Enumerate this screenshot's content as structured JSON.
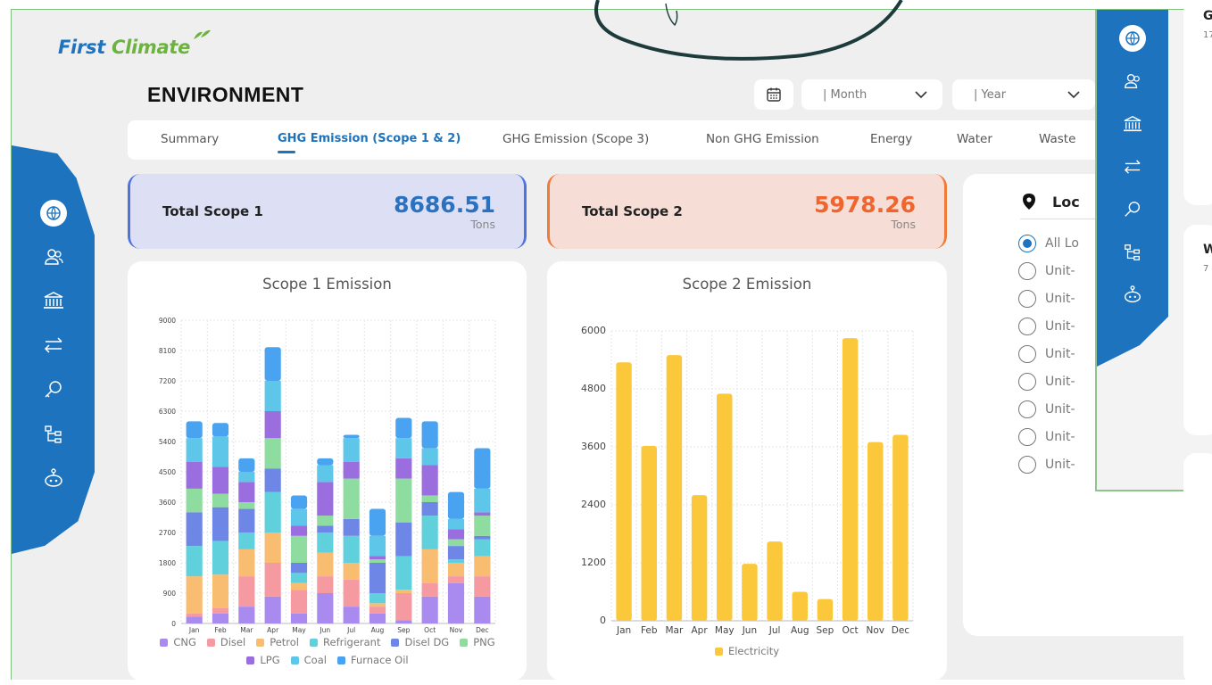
{
  "brand": {
    "name_first": "First",
    "name_second": "Climate",
    "colors": {
      "primary": "#1e73be",
      "green": "#6cb33f"
    }
  },
  "page_title": "ENVIRONMENT",
  "filters": {
    "month": "| Month",
    "year": "| Year"
  },
  "tabs": [
    {
      "label": "Summary",
      "active": false
    },
    {
      "label": "GHG Emission (Scope 1 & 2)",
      "active": true
    },
    {
      "label": "GHG Emission (Scope 3)",
      "active": false
    },
    {
      "label": "Non GHG Emission",
      "active": false
    },
    {
      "label": "Energy",
      "active": false
    },
    {
      "label": "Water",
      "active": false
    },
    {
      "label": "Waste",
      "active": false
    }
  ],
  "sidebar_icons": [
    "globe-icon",
    "users-icon",
    "building-icon",
    "transfer-icon",
    "leaf-key-icon",
    "hierarchy-icon",
    "robot-icon"
  ],
  "totals": {
    "scope1": {
      "label": "Total Scope 1",
      "value": "8686.51",
      "unit": "Tons",
      "color": "#2a72c0"
    },
    "scope2": {
      "label": "Total Scope 2",
      "value": "5978.26",
      "unit": "Tons",
      "color": "#f0642e"
    }
  },
  "location": {
    "title": "Loc",
    "options": [
      "All Lo",
      "Unit-",
      "Unit-",
      "Unit-",
      "Unit-",
      "Unit-",
      "Unit-",
      "Unit-",
      "Unit-"
    ],
    "selected_index": 0
  },
  "overlay_cards": [
    {
      "title": "G",
      "sub": "17"
    },
    {
      "title": "W",
      "sub": "7"
    }
  ],
  "chart_data": [
    {
      "type": "bar",
      "stacked": true,
      "title": "Scope 1 Emission",
      "categories": [
        "Jan",
        "Feb",
        "Mar",
        "Apr",
        "May",
        "Jun",
        "Jul",
        "Aug",
        "Sep",
        "Oct",
        "Nov",
        "Dec"
      ],
      "ylim": [
        0,
        9000
      ],
      "yticks": [
        0,
        900,
        1800,
        2700,
        3600,
        4500,
        5400,
        6300,
        7200,
        8100,
        9000
      ],
      "series": [
        {
          "name": "CNG",
          "color": "#a98bf0",
          "values": [
            200,
            300,
            500,
            800,
            300,
            900,
            500,
            300,
            100,
            800,
            1200,
            800
          ]
        },
        {
          "name": "Disel",
          "color": "#f59aa0",
          "values": [
            100,
            150,
            900,
            1000,
            700,
            500,
            800,
            200,
            800,
            400,
            200,
            600
          ]
        },
        {
          "name": "Petrol",
          "color": "#f9bd72",
          "values": [
            1100,
            1000,
            800,
            900,
            200,
            700,
            500,
            100,
            100,
            1000,
            400,
            600
          ]
        },
        {
          "name": "Refrigerant",
          "color": "#5fd0dc",
          "values": [
            900,
            1000,
            500,
            1200,
            300,
            600,
            800,
            300,
            1000,
            1000,
            100,
            500
          ]
        },
        {
          "name": "Disel DG",
          "color": "#6e86e6",
          "values": [
            1000,
            1000,
            700,
            700,
            300,
            200,
            500,
            900,
            1000,
            400,
            400,
            100
          ]
        },
        {
          "name": "PNG",
          "color": "#8fdca0",
          "values": [
            700,
            400,
            200,
            900,
            800,
            300,
            1200,
            100,
            1300,
            200,
            200,
            600
          ]
        },
        {
          "name": "LPG",
          "color": "#9b6ee0",
          "values": [
            800,
            800,
            600,
            800,
            300,
            1000,
            500,
            100,
            600,
            900,
            300,
            100
          ]
        },
        {
          "name": "Coal",
          "color": "#5ec6e8",
          "values": [
            700,
            900,
            300,
            900,
            500,
            500,
            700,
            600,
            600,
            500,
            300,
            700
          ]
        },
        {
          "name": "Furnace Oil",
          "color": "#4aa3f0",
          "values": [
            500,
            400,
            400,
            1000,
            400,
            200,
            100,
            800,
            600,
            800,
            800,
            1200
          ]
        }
      ]
    },
    {
      "type": "bar",
      "title": "Scope 2 Emission",
      "categories": [
        "Jan",
        "Feb",
        "Mar",
        "Apr",
        "May",
        "Jun",
        "Jul",
        "Aug",
        "Sep",
        "Oct",
        "Nov",
        "Dec"
      ],
      "ylim": [
        0,
        6000
      ],
      "yticks": [
        0,
        1200,
        2400,
        3600,
        4800,
        6000
      ],
      "series": [
        {
          "name": "Electricity",
          "color": "#fbc83b",
          "values": [
            5350,
            3620,
            5500,
            2600,
            4700,
            1180,
            1640,
            600,
            450,
            5850,
            3700,
            3850
          ]
        }
      ]
    }
  ]
}
